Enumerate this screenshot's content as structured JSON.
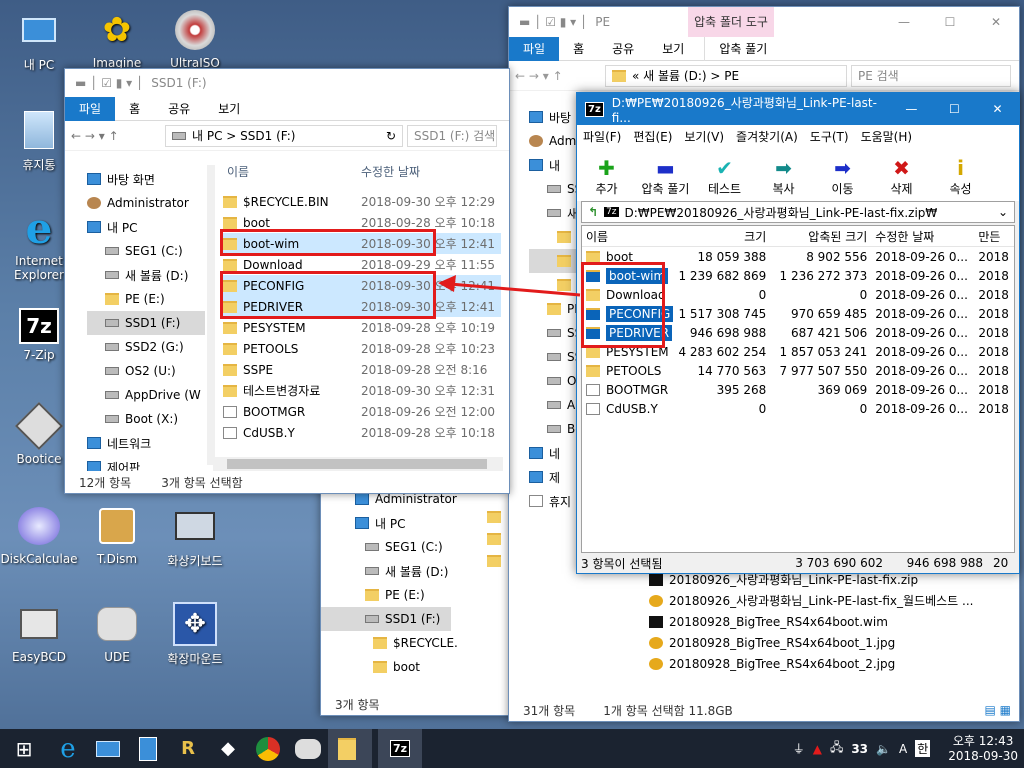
{
  "desktop_icons": [
    {
      "label": "내 PC",
      "icon": "pc-icon"
    },
    {
      "label": "Imagine",
      "icon": "imagine-icon"
    },
    {
      "label": "UltraISO",
      "icon": "ultraiso-icon"
    },
    {
      "label": "휴지통",
      "icon": "recycle-bin-icon"
    },
    {
      "label": "Internet Explorer",
      "icon": "ie-icon"
    },
    {
      "label": "7-Zip",
      "icon": "7zip-icon"
    },
    {
      "label": "Bootice",
      "icon": "bootice-icon"
    },
    {
      "label": "DiskCalculae",
      "icon": "disk-calc-icon"
    },
    {
      "label": "T.Dism",
      "icon": "tdism-icon"
    },
    {
      "label": "화상키보드",
      "icon": "keyboard-icon"
    },
    {
      "label": "EasyBCD",
      "icon": "easybcd-icon"
    },
    {
      "label": "UDE",
      "icon": "ude-icon"
    },
    {
      "label": "확장마운트",
      "icon": "mount-icon"
    }
  ],
  "explorer_ssd1": {
    "title": "SSD1 (F:)",
    "tabs": [
      "파일",
      "홈",
      "공유",
      "보기"
    ],
    "address": "내 PC  >  SSD1 (F:)",
    "search_placeholder": "SSD1 (F:) 검색",
    "col_name": "이름",
    "col_date": "수정한 날짜",
    "nav": [
      "바탕 화면",
      "Administrator",
      "내 PC",
      "SEG1 (C:)",
      "새 볼륨 (D:)",
      "PE (E:)",
      "SSD1 (F:)",
      "SSD2 (G:)",
      "OS2 (U:)",
      "AppDrive (W",
      "Boot (X:)",
      "네트워크",
      "제어판"
    ],
    "files": [
      {
        "name": "$RECYCLE.BIN",
        "date": "2018-09-30 오후 12:29",
        "type": "folder"
      },
      {
        "name": "boot",
        "date": "2018-09-28 오후 10:18",
        "type": "folder"
      },
      {
        "name": "boot-wim",
        "date": "2018-09-30 오후 12:41",
        "type": "folder",
        "sel": true
      },
      {
        "name": "Download",
        "date": "2018-09-29 오후 11:55",
        "type": "folder"
      },
      {
        "name": "PECONFIG",
        "date": "2018-09-30 오후 12:41",
        "type": "folder",
        "sel": true
      },
      {
        "name": "PEDRIVER",
        "date": "2018-09-30 오후 12:41",
        "type": "folder",
        "sel": true
      },
      {
        "name": "PESYSTEM",
        "date": "2018-09-28 오후 10:19",
        "type": "folder"
      },
      {
        "name": "PETOOLS",
        "date": "2018-09-28 오후 10:23",
        "type": "folder"
      },
      {
        "name": "SSPE",
        "date": "2018-09-28 오전 8:16",
        "type": "folder"
      },
      {
        "name": "테스트변경자료",
        "date": "2018-09-30 오후 12:31",
        "type": "folder"
      },
      {
        "name": "BOOTMGR",
        "date": "2018-09-26 오전 12:00",
        "type": "file"
      },
      {
        "name": "CdUSB.Y",
        "date": "2018-09-28 오후 10:18",
        "type": "file"
      }
    ],
    "status_count": "12개 항목",
    "status_sel": "3개 항목 선택함"
  },
  "explorer_pe": {
    "title": "PE",
    "ribbon_context": "압축 폴더 도구",
    "tabs": [
      "파일",
      "홈",
      "공유",
      "보기"
    ],
    "context_tab": "압축 풀기",
    "address": "«  새 볼륨 (D:)  >  PE",
    "search_placeholder": "PE 검색",
    "nav": [
      "바탕",
      "Adm",
      "내",
      "SS",
      "새",
      "",
      "",
      "",
      "PE",
      "SS",
      "SS",
      "O",
      "A",
      "Bo",
      "네",
      "제",
      "휴지"
    ],
    "files_below": [
      "20180926_사랑과평화님_Link-PE-last-fix.zip",
      "20180926_사랑과평화님_Link-PE-last-fix_월드베스트 ...",
      "20180928_BigTree_RS4x64boot.wim",
      "20180928_BigTree_RS4x64boot_1.jpg",
      "20180928_BigTree_RS4x64boot_2.jpg"
    ],
    "status_count": "31개 항목",
    "status_sel": "1개 항목 선택함 11.8GB"
  },
  "explorer_back": {
    "nav": [
      "바탕 화면",
      "Administrator",
      "내 PC",
      "SEG1 (C:)",
      "새 볼륨 (D:)",
      "PE (E:)",
      "SSD1 (F:)",
      "$RECYCLE.",
      "boot"
    ],
    "status": "3개 항목"
  },
  "sevenzip": {
    "title": "D:₩PE₩20180926_사랑과평화님_Link-PE-last-fi...",
    "menu": [
      "파일(F)",
      "편집(E)",
      "보기(V)",
      "즐겨찾기(A)",
      "도구(T)",
      "도움말(H)"
    ],
    "tools": [
      {
        "label": "추가",
        "icon": "plus-icon",
        "glyph": "✚",
        "color": "#1aa31a"
      },
      {
        "label": "압축 풀기",
        "icon": "minus-icon",
        "glyph": "▬",
        "color": "#1d2fc9"
      },
      {
        "label": "테스트",
        "icon": "check-icon",
        "glyph": "✔",
        "color": "#1ab3b3"
      },
      {
        "label": "복사",
        "icon": "copy-arrow-icon",
        "glyph": "➡",
        "color": "#138a8a"
      },
      {
        "label": "이동",
        "icon": "move-arrow-icon",
        "glyph": "➡",
        "color": "#1d2fc9"
      },
      {
        "label": "삭제",
        "icon": "delete-icon",
        "glyph": "✖",
        "color": "#d01818"
      },
      {
        "label": "속성",
        "icon": "info-icon",
        "glyph": "i",
        "color": "#d4a800"
      }
    ],
    "path": "D:₩PE₩20180926_사랑과평화님_Link-PE-last-fix.zip₩",
    "headers": [
      "이름",
      "크기",
      "압축된 크기",
      "수정한 날짜",
      "만든"
    ],
    "rows": [
      {
        "name": "boot",
        "size": "18 059 388",
        "packed": "8 902 556",
        "date": "2018-09-26 0...",
        "made": "2018",
        "sel": false,
        "type": "folder"
      },
      {
        "name": "boot-wim",
        "size": "1 239 682 869",
        "packed": "1 236 272 373",
        "date": "2018-09-26 0...",
        "made": "2018",
        "sel": true,
        "type": "folder"
      },
      {
        "name": "Download",
        "size": "0",
        "packed": "0",
        "date": "2018-09-26 0...",
        "made": "2018",
        "sel": false,
        "type": "folder"
      },
      {
        "name": "PECONFIG",
        "size": "1 517 308 745",
        "packed": "970 659 485",
        "date": "2018-09-26 0...",
        "made": "2018",
        "sel": true,
        "type": "folder"
      },
      {
        "name": "PEDRIVER",
        "size": "946 698 988",
        "packed": "687 421 506",
        "date": "2018-09-26 0...",
        "made": "2018",
        "sel": true,
        "type": "folder"
      },
      {
        "name": "PESYSTEM",
        "size": "4 283 602 254",
        "packed": "1 857 053 241",
        "date": "2018-09-26 0...",
        "made": "2018",
        "sel": false,
        "type": "folder"
      },
      {
        "name": "PETOOLS",
        "size": "14 770 563",
        "packed": "7 977 507 550",
        "date": "2018-09-26 0...",
        "made": "2018",
        "sel": false,
        "type": "folder"
      },
      {
        "name": "BOOTMGR",
        "size": "395 268",
        "packed": "369 069",
        "date": "2018-09-26 0...",
        "made": "2018",
        "sel": false,
        "type": "file"
      },
      {
        "name": "CdUSB.Y",
        "size": "0",
        "packed": "0",
        "date": "2018-09-26 0...",
        "made": "2018",
        "sel": false,
        "type": "file"
      }
    ],
    "status": [
      "3 항목이 선택됨",
      "3 703 690 602",
      "946 698 988",
      "20"
    ]
  },
  "taskbar": {
    "time": "오후 12:43",
    "date": "2018-09-30",
    "ime": "한",
    "lang_icon": "A",
    "tray_num": "33"
  }
}
